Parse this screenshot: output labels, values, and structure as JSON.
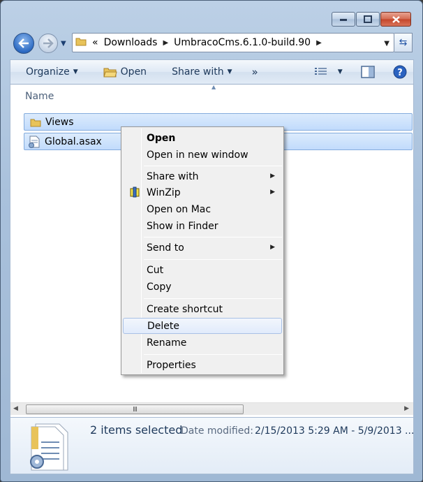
{
  "window": {
    "caption_buttons": [
      "minimize",
      "maximize",
      "close"
    ]
  },
  "address": {
    "overflow": "«",
    "crumbs": [
      "Downloads",
      "UmbracoCms.6.1.0-build.90"
    ]
  },
  "toolbar": {
    "organize": "Organize",
    "open": "Open",
    "share_with": "Share with",
    "more": "»"
  },
  "list": {
    "column_name": "Name",
    "items": [
      {
        "name": "Views",
        "icon": "folder-icon"
      },
      {
        "name": "Global.asax",
        "icon": "asax-file-icon"
      }
    ],
    "scroll_grip": "III"
  },
  "details": {
    "count": "2 items selected",
    "date_label": "Date modified:",
    "date_value": "2/15/2013 5:29 AM - 5/9/2013 ..."
  },
  "context_menu": {
    "open": "Open",
    "open_new_window": "Open in new window",
    "share_with": "Share with",
    "winzip": "WinZip",
    "open_on_mac": "Open on Mac",
    "show_in_finder": "Show in Finder",
    "send_to": "Send to",
    "cut": "Cut",
    "copy": "Copy",
    "create_shortcut": "Create shortcut",
    "delete": "Delete",
    "rename": "Rename",
    "properties": "Properties"
  }
}
